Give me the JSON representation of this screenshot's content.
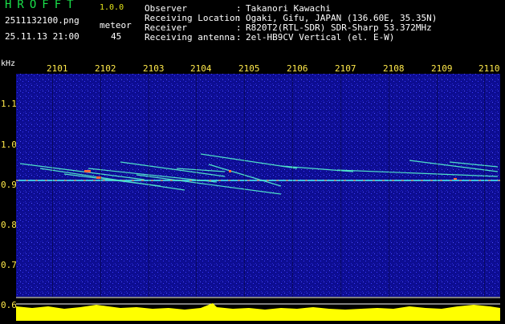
{
  "header": {
    "app_title": "HROFFT",
    "app_version": "1.0.0",
    "file_name": "2511132100.png",
    "date_time": "25.11.13 21:00",
    "meteor_label": "meteor",
    "meteor_count": "45"
  },
  "metadata": [
    {
      "key": "Observer",
      "sep": ":",
      "value": "Takanori Kawachi"
    },
    {
      "key": "Receiving Location",
      "sep": ":",
      "value": "Ogaki, Gifu, JAPAN (136.60E, 35.35N)"
    },
    {
      "key": "Receiver",
      "sep": ":",
      "value": "R820T2(RTL-SDR) SDR-Sharp 53.372MHz"
    },
    {
      "key": "Receiving antenna",
      "sep": ":",
      "value": "2el-HB9CV Vertical (el. E-W)"
    }
  ],
  "spectrogram": {
    "unit": "kHz",
    "time_ticks": [
      "2101",
      "2102",
      "2103",
      "2104",
      "2105",
      "2106",
      "2107",
      "2108",
      "2109",
      "2110"
    ],
    "freq_ticks": [
      "1.1",
      "1.0",
      "0.9",
      "0.8",
      "0.7",
      "0.6"
    ],
    "colors": {
      "background": "#0d0d92",
      "tick": "#ffe94a",
      "carrier": "#ff5a3c",
      "trail": "#4fe0c8",
      "histogram": "#ffff00",
      "histogram_base": "#00c8ff"
    }
  }
}
